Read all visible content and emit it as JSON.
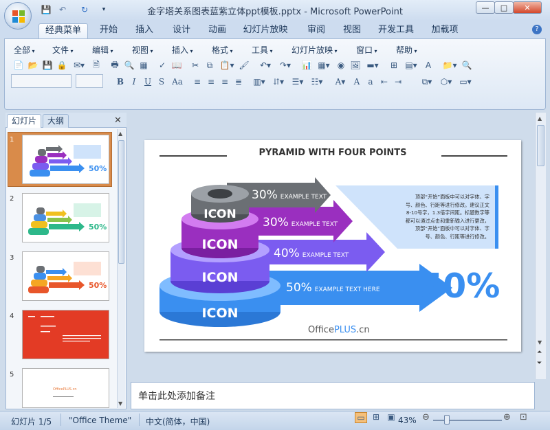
{
  "window": {
    "title": "金字塔关系图表蓝紫立体ppt模板.pptx - Microsoft PowerPoint",
    "controls": {
      "minimize": "—",
      "maximize": "□",
      "close": "✕"
    }
  },
  "qat": {
    "save": "💾",
    "undo": "↶",
    "redo": "↻",
    "more": "▾"
  },
  "ribbon": {
    "tabs": [
      "经典菜单",
      "开始",
      "插入",
      "设计",
      "动画",
      "幻灯片放映",
      "审阅",
      "视图",
      "开发工具",
      "加载项"
    ],
    "active_tab": "经典菜单",
    "menus": [
      "全部",
      "文件",
      "编辑",
      "视图",
      "插入",
      "格式",
      "工具",
      "幻灯片放映",
      "窗口",
      "帮助"
    ],
    "help": "?"
  },
  "left_pane": {
    "tabs": [
      "幻灯片",
      "大纲"
    ],
    "close": "✕",
    "slides": [
      {
        "num": "1",
        "selected": true
      },
      {
        "num": "2"
      },
      {
        "num": "3"
      },
      {
        "num": "4"
      },
      {
        "num": "5",
        "mini_text": "OfficePLUS.cn"
      }
    ]
  },
  "slide": {
    "title": "PYRAMID WITH FOUR POINTS",
    "layers": [
      {
        "icon": "ICON",
        "percent": "30%",
        "text": "EXAMPLE TEXT",
        "color": "#6b6f74"
      },
      {
        "icon": "ICON",
        "percent": "30%",
        "text": "EXAMPLE TEXT",
        "color": "#9a2fbf"
      },
      {
        "icon": "ICON",
        "percent": "40%",
        "text": "EXAMPLE TEXT",
        "color": "#7b5cf0"
      },
      {
        "icon": "ICON",
        "percent": "50%",
        "text": "EXAMPLE TEXT HERE",
        "color": "#3a8ff0"
      }
    ],
    "big_percent": "50%",
    "note_lines": [
      "顶部“开始”面板中可以对字体、字",
      "号、颜色、行距等进行修改。建议正文",
      "8-10号字，1.3倍字间距。标题数字等",
      "都可以通过点击和重新输入进行更改，",
      "顶部“开始”面板中可以对字体、字",
      "号、颜色、行距等进行修改。"
    ],
    "brand_office": "Office",
    "brand_plus": "PLUS",
    "brand_cn": ".cn"
  },
  "notes_placeholder": "单击此处添加备注",
  "status": {
    "slide_info": "幻灯片 1/5",
    "theme": "\"Office Theme\"",
    "language": "中文(简体，中国)",
    "zoom": "43%"
  },
  "colors": {
    "accent_blue": "#3a8ff0",
    "purple": "#9a2fbf",
    "violet": "#7b5cf0",
    "grey": "#6b6f74",
    "selected_thumb": "#d98b4a"
  }
}
